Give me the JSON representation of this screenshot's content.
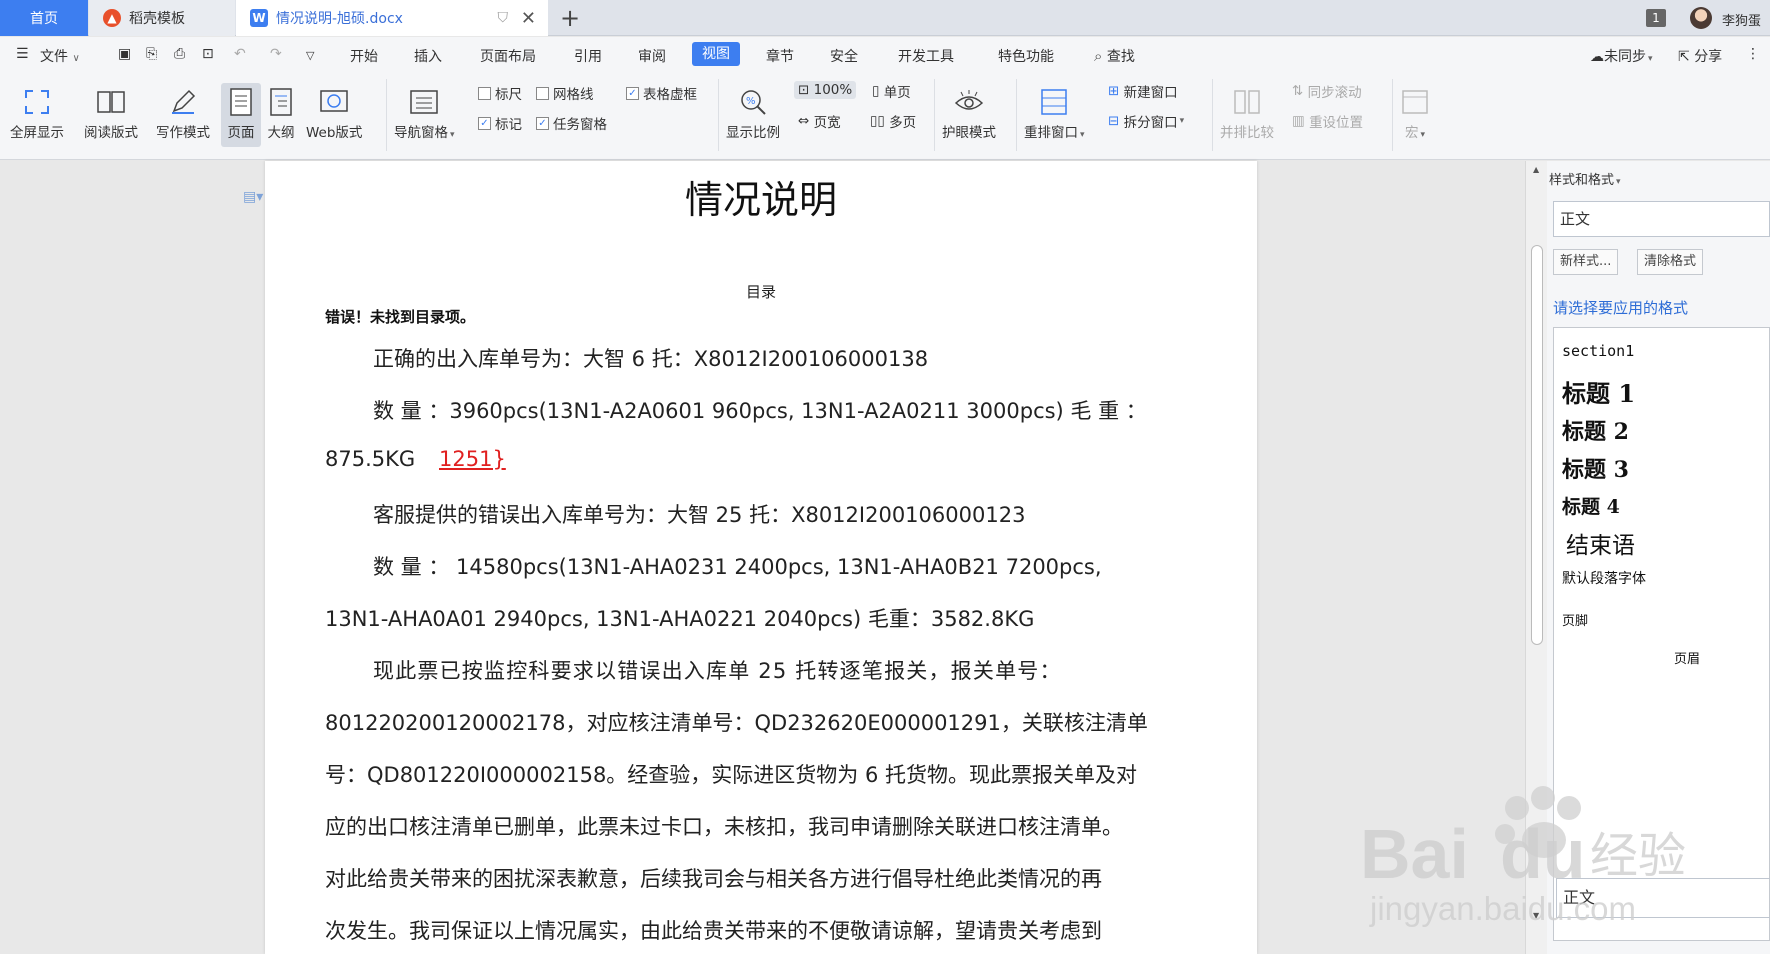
{
  "tabs": {
    "home": "首页",
    "template": "稻壳模板",
    "doc": "情况说明-旭硕.docx",
    "count": "1",
    "user": "李狗蛋"
  },
  "menu": {
    "file": "文件",
    "items": [
      "开始",
      "插入",
      "页面布局",
      "引用",
      "审阅",
      "视图",
      "章节",
      "安全",
      "开发工具",
      "特色功能"
    ],
    "search": "查找",
    "sync": "未同步",
    "share": "分享"
  },
  "toolbar": {
    "fullscreen": "全屏显示",
    "reading": "阅读版式",
    "writing": "写作模式",
    "page": "页面",
    "outline": "大纲",
    "web": "Web版式",
    "nav": "导航窗格",
    "ruler": "标尺",
    "gridlines": "网格线",
    "table_frame": "表格虚框",
    "marks": "标记",
    "task_pane": "任务窗格",
    "zoom_label": "显示比例",
    "zoom_value": "100%",
    "page_width": "页宽",
    "single_page": "单页",
    "multi_page": "多页",
    "eye_care": "护眼模式",
    "rearrange": "重排窗口",
    "new_window": "新建窗口",
    "split_window": "拆分窗口",
    "side_compare": "并排比较",
    "sync_scroll": "同步滚动",
    "reset_position": "重设位置",
    "macro": "宏"
  },
  "document": {
    "title": "情况说明",
    "toc": "目录",
    "error": "错误！未找到目录项。",
    "lines": [
      "正确的出入库单号为：大智 6 托：X8012I200106000138",
      "数 量 ：3960pcs(13N1-A2A0601 960pcs, 13N1-A2A0211 3000pcs)    毛 重 ：",
      "875.5KG",
      "1251}",
      "客服提供的错误出入库单号为：大智 25 托：X8012I200106000123",
      "数  量  ：  14580pcs(13N1-AHA0231   2400pcs,   13N1-AHA0B21   7200pcs,",
      "13N1-AHA0A01 2940pcs, 13N1-AHA0221 2040pcs)     毛重：3582.8KG",
      "现此票已按监控科要求以错误出入库单 25 托转逐笔报关，报关单号：",
      "801220200120002178，对应核注清单号：QD232620E000001291，关联核注清单",
      "号：QD801220I000002158。经查验，实际进区货物为 6 托货物。现此票报关单及对",
      "应的出口核注清单已删单，此票未过卡口，未核扣，我司申请删除关联进口核注清单。",
      "对此给贵关带来的困扰深表歉意，后续我司会与相关各方进行倡导杜绝此类情况的再",
      "次发生。我司保证以上情况属实，由此给贵关带来的不便敬请谅解，望请贵关考虑到"
    ]
  },
  "side_panel": {
    "title": "样式和格式",
    "current_style": "正文",
    "new_style": "新样式...",
    "clear_format": "清除格式",
    "hint": "请选择要应用的格式",
    "styles": [
      "section1",
      "标题  1",
      "标题  2",
      "标题  3",
      "标题  4",
      "结束语",
      "默认段落字体",
      "页脚",
      "页眉",
      "正文"
    ]
  },
  "watermark": {
    "brand": "Bai",
    "brand2": "du",
    "cn": "经验",
    "url": "jingyan.baidu.com"
  },
  "colors": {
    "accent": "#3d7ef0",
    "red_text": "#e02020",
    "link_blue": "#2e6dd6"
  }
}
